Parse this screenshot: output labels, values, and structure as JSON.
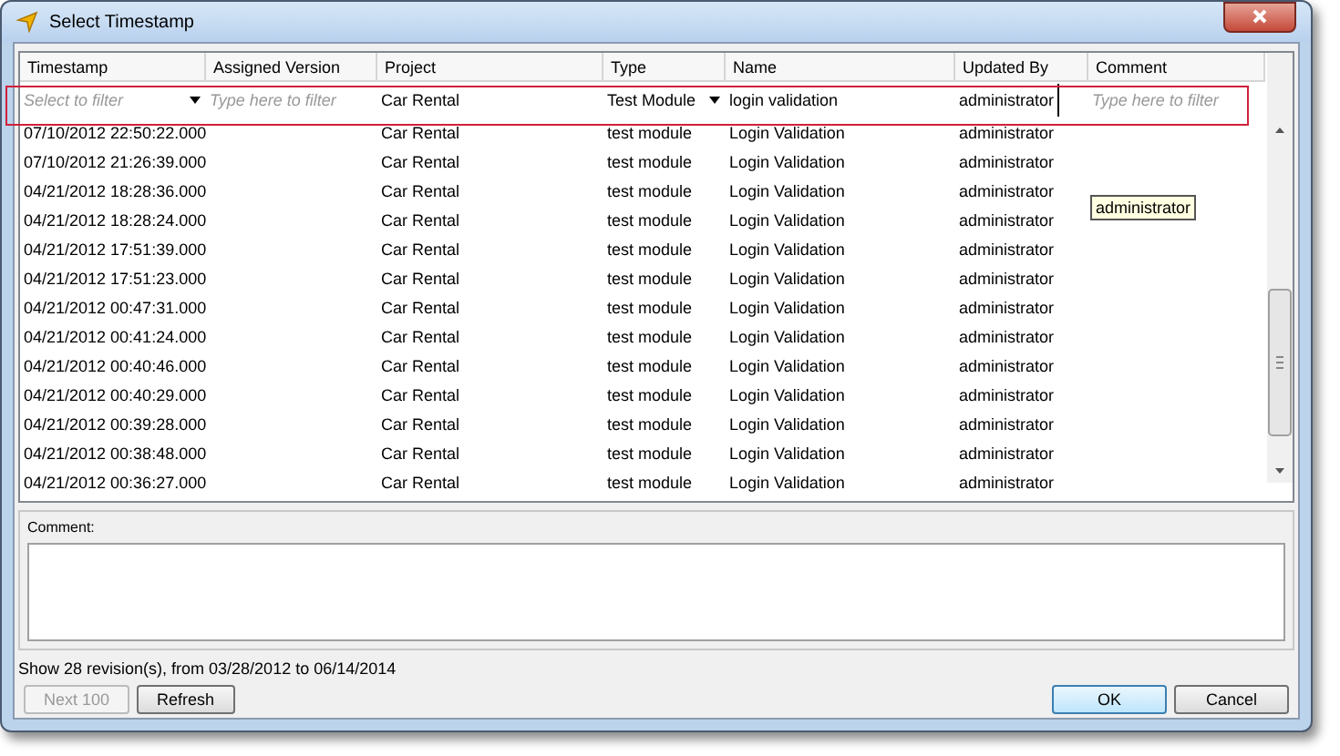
{
  "window": {
    "title": "Select Timestamp"
  },
  "table": {
    "columns": [
      "Timestamp",
      "Assigned Version",
      "Project",
      "Type",
      "Name",
      "Updated By",
      "Comment"
    ],
    "filters": [
      {
        "kind": "dropdown",
        "placeholder": "Select to filter"
      },
      {
        "kind": "text",
        "placeholder": "Type here to filter"
      },
      {
        "kind": "text",
        "value": "Car Rental"
      },
      {
        "kind": "dropdown",
        "value": "Test Module"
      },
      {
        "kind": "text",
        "value": "login validation"
      },
      {
        "kind": "text",
        "value": "administrator",
        "focused": true
      },
      {
        "kind": "text",
        "placeholder": "Type here to filter"
      }
    ],
    "rows": [
      [
        "07/10/2012 22:50:22.000",
        "",
        "Car Rental",
        "test module",
        "Login Validation",
        "administrator",
        ""
      ],
      [
        "07/10/2012 21:26:39.000",
        "",
        "Car Rental",
        "test module",
        "Login Validation",
        "administrator",
        ""
      ],
      [
        "04/21/2012 18:28:36.000",
        "",
        "Car Rental",
        "test module",
        "Login Validation",
        "administrator",
        ""
      ],
      [
        "04/21/2012 18:28:24.000",
        "",
        "Car Rental",
        "test module",
        "Login Validation",
        "administrator",
        ""
      ],
      [
        "04/21/2012 17:51:39.000",
        "",
        "Car Rental",
        "test module",
        "Login Validation",
        "administrator",
        ""
      ],
      [
        "04/21/2012 17:51:23.000",
        "",
        "Car Rental",
        "test module",
        "Login Validation",
        "administrator",
        ""
      ],
      [
        "04/21/2012 00:47:31.000",
        "",
        "Car Rental",
        "test module",
        "Login Validation",
        "administrator",
        ""
      ],
      [
        "04/21/2012 00:41:24.000",
        "",
        "Car Rental",
        "test module",
        "Login Validation",
        "administrator",
        ""
      ],
      [
        "04/21/2012 00:40:46.000",
        "",
        "Car Rental",
        "test module",
        "Login Validation",
        "administrator",
        ""
      ],
      [
        "04/21/2012 00:40:29.000",
        "",
        "Car Rental",
        "test module",
        "Login Validation",
        "administrator",
        ""
      ],
      [
        "04/21/2012 00:39:28.000",
        "",
        "Car Rental",
        "test module",
        "Login Validation",
        "administrator",
        ""
      ],
      [
        "04/21/2012 00:38:48.000",
        "",
        "Car Rental",
        "test module",
        "Login Validation",
        "administrator",
        ""
      ],
      [
        "04/21/2012 00:36:27.000",
        "",
        "Car Rental",
        "test module",
        "Login Validation",
        "administrator",
        ""
      ]
    ],
    "tooltip": "administrator"
  },
  "comment": {
    "label": "Comment:"
  },
  "status": "Show 28 revision(s), from 03/28/2012 to 06/14/2014",
  "buttons_left": [
    {
      "label": "Next 100",
      "disabled": true
    },
    {
      "label": "Refresh",
      "disabled": false
    }
  ],
  "buttons_right": [
    {
      "label": "OK",
      "default": true
    },
    {
      "label": "Cancel",
      "default": false
    }
  ]
}
